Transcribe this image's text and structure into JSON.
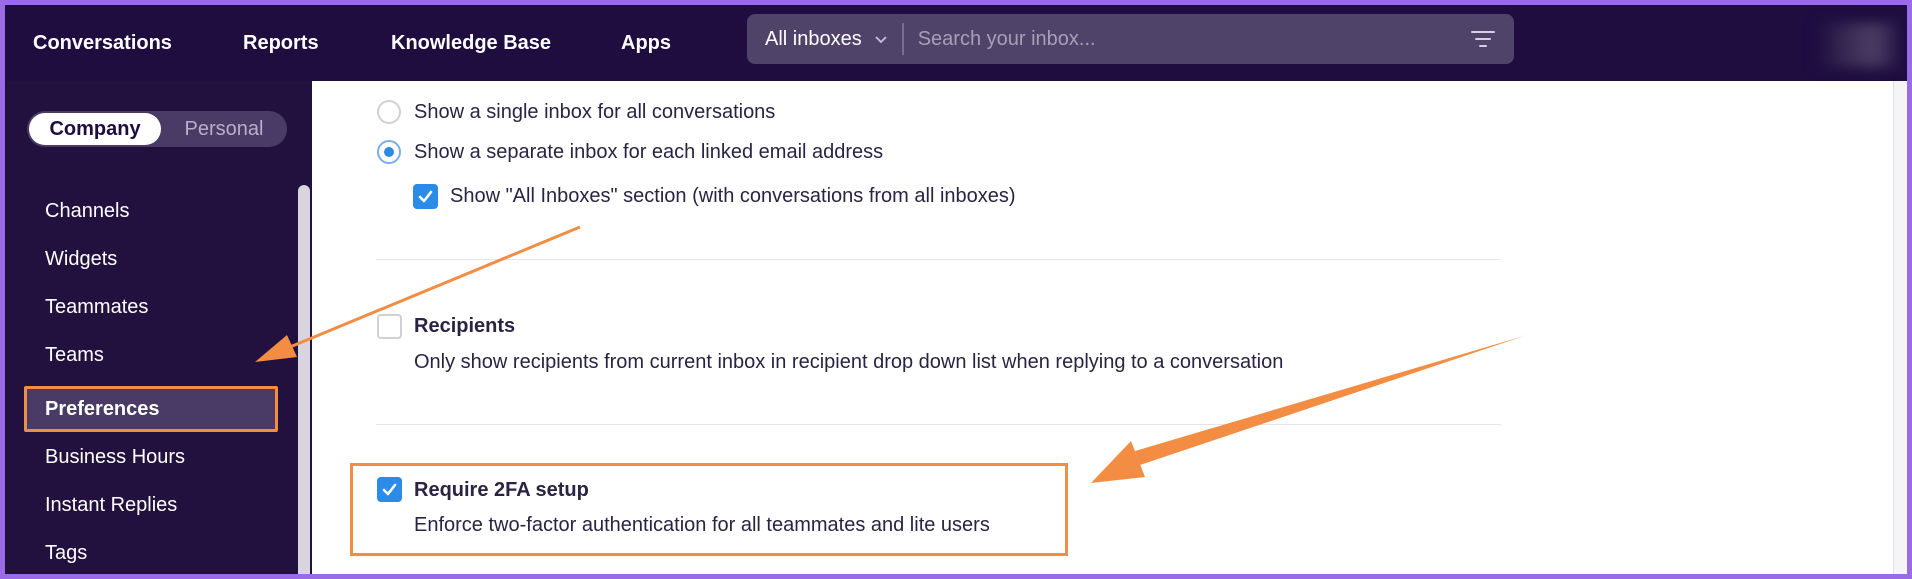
{
  "topbar": {
    "nav": [
      "Conversations",
      "Reports",
      "Knowledge Base",
      "Apps"
    ],
    "inbox_select": "All inboxes",
    "search_placeholder": "Search your inbox..."
  },
  "sidebar": {
    "segments": {
      "active": "Company",
      "inactive": "Personal"
    },
    "items": [
      "Channels",
      "Widgets",
      "Teammates",
      "Teams",
      "Preferences",
      "Business Hours",
      "Instant Replies",
      "Tags"
    ],
    "active_item": "Preferences"
  },
  "main": {
    "inbox_options": {
      "single": "Show a single inbox for all conversations",
      "separate": "Show a separate inbox for each linked email address",
      "all_inboxes": "Show \"All Inboxes\" section (with conversations from all inboxes)"
    },
    "recipients": {
      "title": "Recipients",
      "description": "Only show recipients from current inbox in recipient drop down list when replying to a conversation"
    },
    "twofa": {
      "title": "Require 2FA setup",
      "description": "Enforce two-factor authentication for all teammates and lite users"
    }
  },
  "colors": {
    "nav_bg": "#1f0d40",
    "sidebar_bg": "#22113f",
    "accent_orange": "#f38d44",
    "check_blue": "#2a8be8",
    "frame_purple": "#9b6ae6"
  }
}
